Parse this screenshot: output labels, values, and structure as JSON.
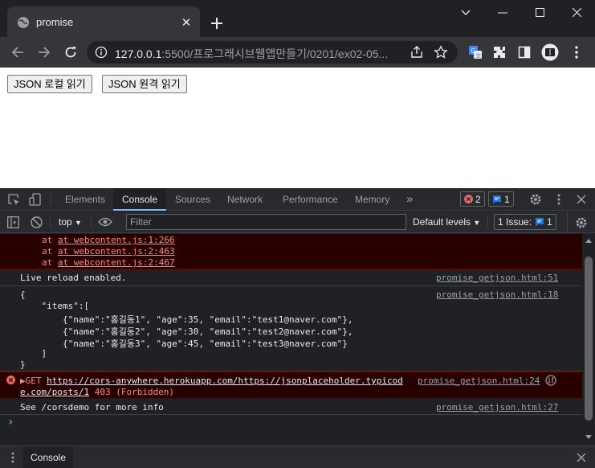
{
  "browser": {
    "tab_title": "promise",
    "url_host": "127.0.0.1",
    "url_rest": ":5500/프로그래시브웹앱만들기/0201/ex02-05...",
    "icons": [
      "globe-icon",
      "close-icon",
      "plus-icon",
      "minimize-icon",
      "maximize-icon",
      "window-close-icon",
      "chevron-down-icon",
      "back-icon",
      "forward-icon",
      "reload-icon",
      "info-icon",
      "share-icon",
      "star-icon",
      "translate-icon",
      "extensions-icon",
      "sidepanel-icon",
      "profile-icon",
      "more-vert-icon"
    ]
  },
  "page": {
    "buttons": [
      "JSON 로컬 읽기",
      "JSON 원격 읽기"
    ]
  },
  "devtools": {
    "tabs": [
      "Elements",
      "Console",
      "Sources",
      "Network",
      "Performance",
      "Memory"
    ],
    "more_tabs": "»",
    "error_count": "2",
    "message_count": "1",
    "context": "top",
    "filter_placeholder": "Filter",
    "levels": "Default levels",
    "issues_label": "1 Issue:",
    "issues_count": "1",
    "drawer_tab": "Console",
    "console": {
      "stack": [
        "at webcontent.js:1:266",
        "at webcontent.js:2:463",
        "at webcontent.js:2:467"
      ],
      "live_reload": "Live reload enabled.",
      "live_reload_src": "promise_getjson.html:51",
      "json_src": "promise_getjson.html:18",
      "json_lines": [
        "{",
        "    \"items\":[",
        "        {\"name\":\"홍길동1\", \"age\":35, \"email\":\"test1@naver.com\"},",
        "        {\"name\":\"홍길동2\", \"age\":30, \"email\":\"test2@naver.com\"},",
        "        {\"name\":\"홍길동3\", \"age\":45, \"email\":\"test3@naver.com\"}",
        "    ]",
        "}"
      ],
      "get_prefix": "▶GET ",
      "get_url_1": "https://cors-anywhere.herokuapp.com/https://jsonplaceholder.typicod",
      "get_url_2": "e.com/posts/1",
      "get_status": " 403 (Forbidden)",
      "get_src": "promise_getjson.html:24",
      "corsdemo": "See /corsdemo for more info",
      "corsdemo_src": "promise_getjson.html:27",
      "prompt": "›"
    },
    "colors": {
      "error_bg": "#290000",
      "accent": "#8ab4f8",
      "error_text": "#f28b82"
    }
  }
}
